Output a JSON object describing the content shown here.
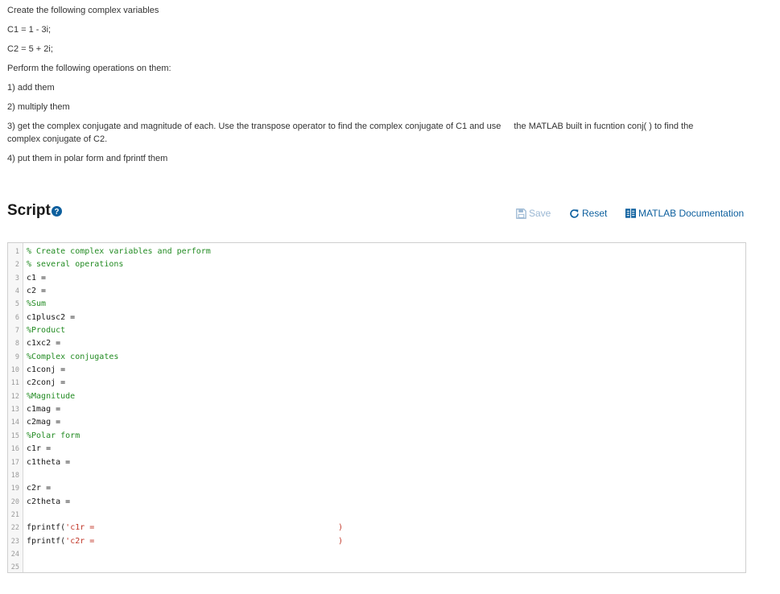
{
  "instructions": {
    "line1": "Create the following complex variables",
    "line2": "C1 = 1 - 3i;",
    "line3": "C2 = 5 + 2i;",
    "line4": "Perform the following operations on them:",
    "line5": "1) add them",
    "line6": "2) multiply them",
    "line7a": "3) get the complex conjugate and magnitude of each.  Use the transpose operator to find the complex conjugate of C1 and use",
    "line7b": "the MATLAB built in fucntion conj( ) to find the",
    "line7c": "complex conjugate of C2.",
    "line8": "4) put them in polar form and fprintf them"
  },
  "script": {
    "title": "Script",
    "help_icon": "question-circle-icon"
  },
  "toolbar": {
    "save_label": "Save",
    "reset_label": "Reset",
    "docs_label": "MATLAB Documentation",
    "save_icon": "floppy-disk-icon",
    "reset_icon": "refresh-icon",
    "docs_icon": "documentation-icon",
    "accent_color": "#0c5f9e",
    "disabled_color": "#9ab7d3"
  },
  "editor": {
    "colors": {
      "comment": "#228b22",
      "error": "#c2392b"
    },
    "lines": [
      {
        "n": "1",
        "text": "% Create complex variables and perform",
        "type": "comment"
      },
      {
        "n": "2",
        "text": "% several operations",
        "type": "comment"
      },
      {
        "n": "3",
        "text": "c1 = ",
        "type": "code"
      },
      {
        "n": "4",
        "text": "c2 = ",
        "type": "code"
      },
      {
        "n": "5",
        "text": "%Sum",
        "type": "comment"
      },
      {
        "n": "6",
        "text": "c1plusc2 = ",
        "type": "code"
      },
      {
        "n": "7",
        "text": "%Product",
        "type": "comment"
      },
      {
        "n": "8",
        "text": "c1xc2 = ",
        "type": "code"
      },
      {
        "n": "9",
        "text": "%Complex conjugates",
        "type": "comment"
      },
      {
        "n": "10",
        "text": "c1conj = ",
        "type": "code"
      },
      {
        "n": "11",
        "text": "c2conj = ",
        "type": "code"
      },
      {
        "n": "12",
        "text": "%Magnitude",
        "type": "comment"
      },
      {
        "n": "13",
        "text": "c1mag = ",
        "type": "code"
      },
      {
        "n": "14",
        "text": "c2mag = ",
        "type": "code"
      },
      {
        "n": "15",
        "text": "%Polar form",
        "type": "comment"
      },
      {
        "n": "16",
        "text": "c1r = ",
        "type": "code"
      },
      {
        "n": "17",
        "text": "c1theta = ",
        "type": "code"
      },
      {
        "n": "18",
        "text": "",
        "type": "code"
      },
      {
        "n": "19",
        "text": "c2r = ",
        "type": "code"
      },
      {
        "n": "20",
        "text": "c2theta = ",
        "type": "code"
      },
      {
        "n": "21",
        "text": "",
        "type": "code"
      },
      {
        "n": "22",
        "text": "fprintf(",
        "type": "fprintf",
        "string": "'c1r = ",
        "close": ")"
      },
      {
        "n": "23",
        "text": "fprintf(",
        "type": "fprintf",
        "string": "'c2r = ",
        "close": ")"
      },
      {
        "n": "24",
        "text": "",
        "type": "code"
      },
      {
        "n": "25",
        "text": "",
        "type": "code"
      }
    ]
  }
}
